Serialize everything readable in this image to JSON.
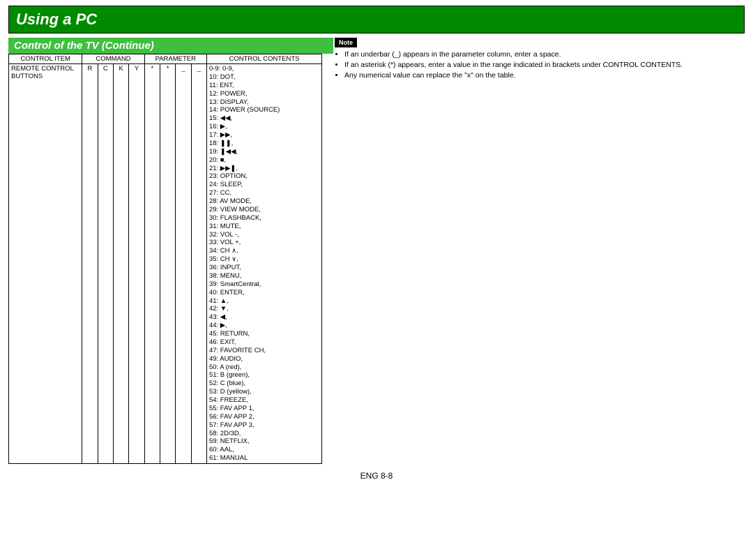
{
  "header": {
    "title": "Using a PC",
    "subtitle": "Control of the TV (Continue)"
  },
  "table": {
    "head": {
      "c1": "CONTROL ITEM",
      "c2": "COMMAND",
      "c3": "PARAMETER",
      "c4": "CONTROL CONTENTS"
    },
    "row": {
      "item": "REMOTE CONTROL BUTTONS",
      "cmd": [
        "R",
        "C",
        "K",
        "Y"
      ],
      "param": [
        "*",
        "*",
        "_",
        "_"
      ],
      "contents": [
        "0-9: 0-9,",
        "10: DOT,",
        "11: ENT,",
        "12: POWER,",
        "13: DISPLAY,",
        "14: POWER (SOURCE)",
        "15: ◀◀,",
        "16: ▶,",
        "17: ▶▶,",
        "18: ❚❚,",
        "19: ❚◀◀,",
        "20: ■,",
        "21: ▶▶❚,",
        "23: OPTION,",
        "24: SLEEP,",
        "27: CC,",
        "28: AV MODE,",
        "29: VIEW MODE,",
        "30: FLASHBACK,",
        "31: MUTE,",
        "32: VOL -,",
        "33: VOL +,",
        "34: CH ∧,",
        "35: CH ∨,",
        "36: INPUT,",
        "38: MENU,",
        "39: SmartCentral,",
        "40: ENTER,",
        "41: ▲,",
        "42: ▼,",
        "43: ◀,",
        "44: ▶,",
        "45: RETURN,",
        "46: EXIT,",
        "47: FAVORITE CH,",
        "49: AUDIO,",
        "50: A (red),",
        "51: B (green),",
        "52: C (blue),",
        "53: D (yellow),",
        "54: FREEZE,",
        "55: FAV APP 1,",
        "56: FAV APP 2,",
        "57: FAV APP 3,",
        "58: 2D/3D,",
        "59: NETFLIX,",
        "60: AAL,",
        "61: MANUAL"
      ]
    }
  },
  "note": {
    "label": "Note",
    "items": [
      "If an underbar (_) appears in the parameter column, enter a space.",
      "If an asterisk (*) appears, enter a value in the range indicated in brackets under CONTROL CONTENTS.",
      "Any numerical value can replace the \"x\" on the table."
    ]
  },
  "footer": "ENG 8-8"
}
